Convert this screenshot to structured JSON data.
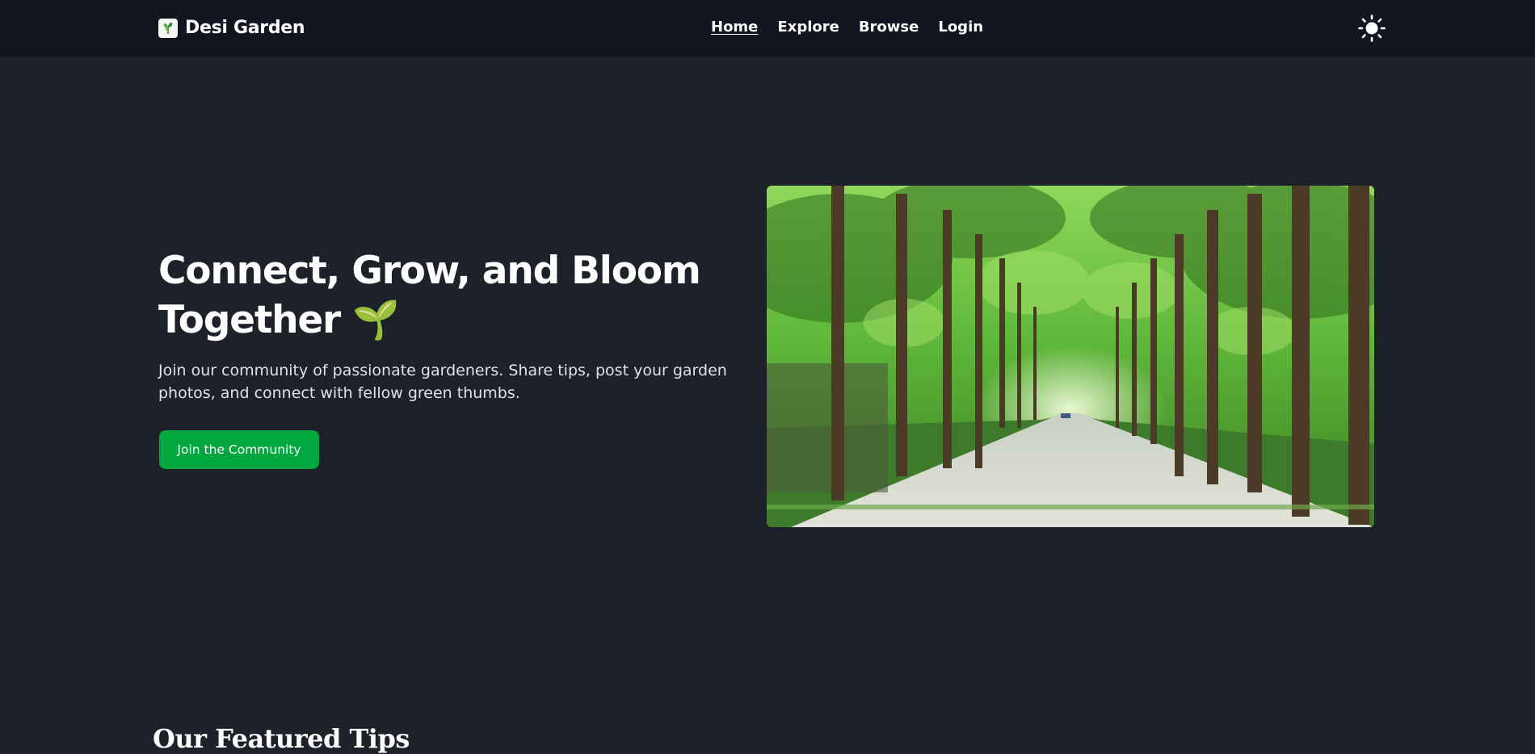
{
  "brand": {
    "name": "Desi Garden",
    "logo_icon": "leaf-logo-icon"
  },
  "nav": {
    "links": [
      {
        "label": "Home",
        "active": true
      },
      {
        "label": "Explore",
        "active": false
      },
      {
        "label": "Browse",
        "active": false
      },
      {
        "label": "Login",
        "active": false
      }
    ],
    "theme_icon": "sun-icon"
  },
  "hero": {
    "title": "Connect, Grow, and Bloom Together",
    "title_emoji": "🌱",
    "description": "Join our community of passionate gardeners. Share tips, post your garden photos, and connect with fellow green thumbs.",
    "button_label": "Join the Community",
    "image_subject": "tree-lined-path-photo"
  },
  "featured": {
    "title": "Our Featured Tips"
  },
  "colors": {
    "navbar_bg": "#10151f",
    "page_bg": "#1d2129",
    "accent_green": "#00a63e"
  }
}
